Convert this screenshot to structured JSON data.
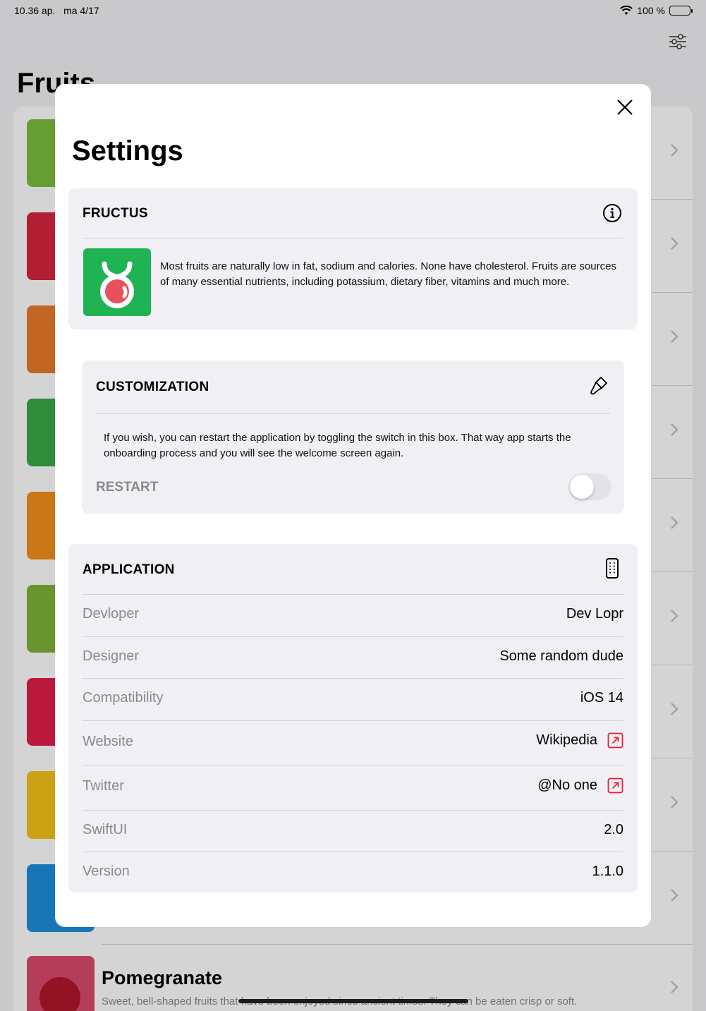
{
  "status_bar": {
    "time": "10.36 ap.",
    "date": "ma 4/17",
    "battery": "100 %"
  },
  "background": {
    "title": "Fruits",
    "rows": [
      {
        "thumb": "#7bbf3e",
        "fruit": "#c8192a"
      },
      {
        "thumb": "#d7263d",
        "fruit": "#b3121f"
      },
      {
        "thumb": "#ea7b2c",
        "fruit": "#f28a1a"
      },
      {
        "thumb": "#3aa846",
        "fruit": "#2f7d32"
      },
      {
        "thumb": "#f28f1b",
        "fruit": "#a8161c"
      },
      {
        "thumb": "#7fb338",
        "fruit": "#66a032"
      },
      {
        "thumb": "#e01d4a",
        "fruit": "#c81e2a"
      },
      {
        "thumb": "#f5c21a",
        "fruit": "#e8b011"
      },
      {
        "thumb": "#1e8fdc",
        "fruit": "#1a5fb4"
      }
    ],
    "last_row": {
      "name": "Pomegranate",
      "description": "Sweet, bell-shaped fruits that have been enjoyed since ancient times. They can be eaten crisp or soft.",
      "thumb": "#d94a6c",
      "fruit": "#b0182b"
    }
  },
  "settings": {
    "title": "Settings",
    "fructus": {
      "label": "FRUCTUS",
      "icon": "info-circle-icon",
      "text": "Most fruits are naturally low in fat, sodium and calories. None have cholesterol. Fruits are sources of many essential nutrients, including potassium, dietary fiber, vitamins and much more."
    },
    "customization": {
      "label": "CUSTOMIZATION",
      "icon": "paintbrush-icon",
      "text": "If you wish, you can restart the application by toggling the switch in this box. That way app starts the onboarding process and you will see the welcome screen again.",
      "toggle_label": "RESTART",
      "toggle_on": false
    },
    "application": {
      "label": "APPLICATION",
      "icon": "ipad-icon",
      "rows": [
        {
          "key": "Devloper",
          "value": "Dev Lopr",
          "link": false
        },
        {
          "key": "Designer",
          "value": "Some random dude",
          "link": false
        },
        {
          "key": "Compatibility",
          "value": "iOS 14",
          "link": false
        },
        {
          "key": "Website",
          "value": "Wikipedia",
          "link": true
        },
        {
          "key": "Twitter",
          "value": "@No one",
          "link": true
        },
        {
          "key": "SwiftUI",
          "value": "2.0",
          "link": false
        },
        {
          "key": "Version",
          "value": "1.1.0",
          "link": false
        }
      ]
    },
    "colors": {
      "accent_link": "#e0223a",
      "logo_green": "#1fb354"
    }
  }
}
